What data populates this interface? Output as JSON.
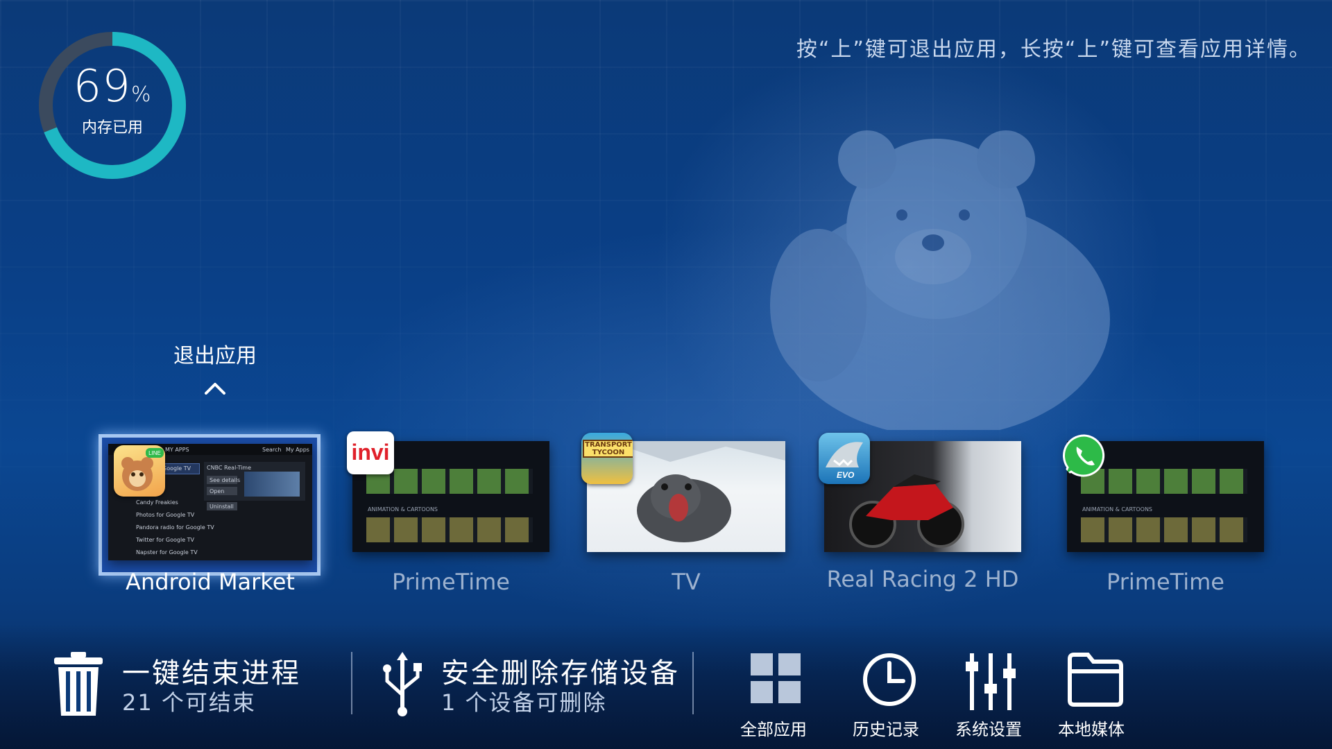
{
  "memory": {
    "percent_value": "69",
    "percent_unit": "%",
    "label": "内存已用",
    "fraction": 0.69
  },
  "hint": "按“上”键可退出应用，长按“上”键可查看应用详情。",
  "exit": {
    "label": "退出应用"
  },
  "apps": [
    {
      "name": "Android Market",
      "selected": true,
      "icon": "line-app-icon"
    },
    {
      "name": "PrimeTime",
      "selected": false,
      "icon": "invi-app-icon",
      "icon_text": "invi"
    },
    {
      "name": "TV",
      "selected": false,
      "icon": "transport-tycoon-icon",
      "icon_text": "TRANSPORT TYCOON"
    },
    {
      "name": "Real Racing 2 HD",
      "selected": false,
      "icon": "hungry-shark-evo-icon",
      "icon_text": "EVO"
    },
    {
      "name": "PrimeTime",
      "selected": false,
      "icon": "whatsapp-icon"
    }
  ],
  "market_shot": {
    "tab": "MY APPS",
    "search": "Search",
    "myapps": "My Apps",
    "detail_title": "CNBC Real-Time",
    "buttons": [
      "See details",
      "Open",
      "Uninstall"
    ],
    "list": [
      "Google TV",
      "Candy Freakies",
      "Photos for Google TV",
      "Pandora radio for Google TV",
      "Twitter for Google TV",
      "Napster for Google TV"
    ]
  },
  "primetime_shot": {
    "section": "ANIMATION & CARTOONS"
  },
  "bottom": {
    "kill": {
      "title": "一键结束进程",
      "sub": "21 个可结束"
    },
    "storage": {
      "title": "安全删除存储设备",
      "sub": "1 个设备可删除"
    },
    "quick": [
      {
        "label": "全部应用",
        "icon": "grid-icon"
      },
      {
        "label": "历史记录",
        "icon": "clock-icon"
      },
      {
        "label": "系统设置",
        "icon": "sliders-icon"
      },
      {
        "label": "本地媒体",
        "icon": "folder-icon"
      }
    ]
  },
  "colors": {
    "ring": "#1eb8c4",
    "ring_track": "#3b4a5e",
    "selected_frame": "#a9c9f2"
  }
}
